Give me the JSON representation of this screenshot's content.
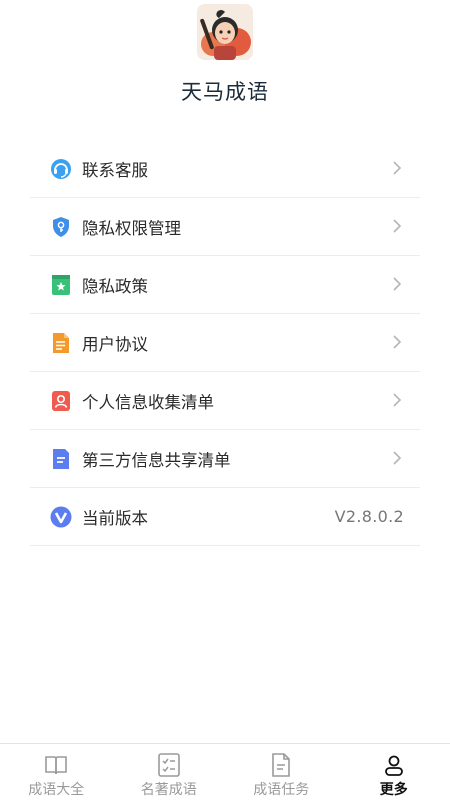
{
  "header": {
    "title": "天马成语",
    "avatar_icon": "cartoon-character-avatar"
  },
  "menu": {
    "items": [
      {
        "label": "联系客服",
        "icon": "headset-support-icon",
        "color": "#3aa0f0",
        "has_chevron": true
      },
      {
        "label": "隐私权限管理",
        "icon": "shield-key-icon",
        "color": "#3d8fe8",
        "has_chevron": true
      },
      {
        "label": "隐私政策",
        "icon": "bookmark-star-icon",
        "color": "#39c17a",
        "has_chevron": true
      },
      {
        "label": "用户协议",
        "icon": "document-lines-icon",
        "color": "#f29b2b",
        "has_chevron": true
      },
      {
        "label": "个人信息收集清单",
        "icon": "person-card-icon",
        "color": "#ef5b4f",
        "has_chevron": true
      },
      {
        "label": "第三方信息共享清单",
        "icon": "file-share-icon",
        "color": "#5b7df0",
        "has_chevron": true
      },
      {
        "label": "当前版本",
        "icon": "version-v-icon",
        "color": "#5b7df0",
        "value": "V2.8.0.2"
      }
    ]
  },
  "tabbar": {
    "tabs": [
      {
        "label": "成语大全",
        "icon": "open-book-icon",
        "active": false
      },
      {
        "label": "名著成语",
        "icon": "checklist-icon",
        "active": false
      },
      {
        "label": "成语任务",
        "icon": "task-document-icon",
        "active": false
      },
      {
        "label": "更多",
        "icon": "user-profile-icon",
        "active": true
      }
    ]
  }
}
